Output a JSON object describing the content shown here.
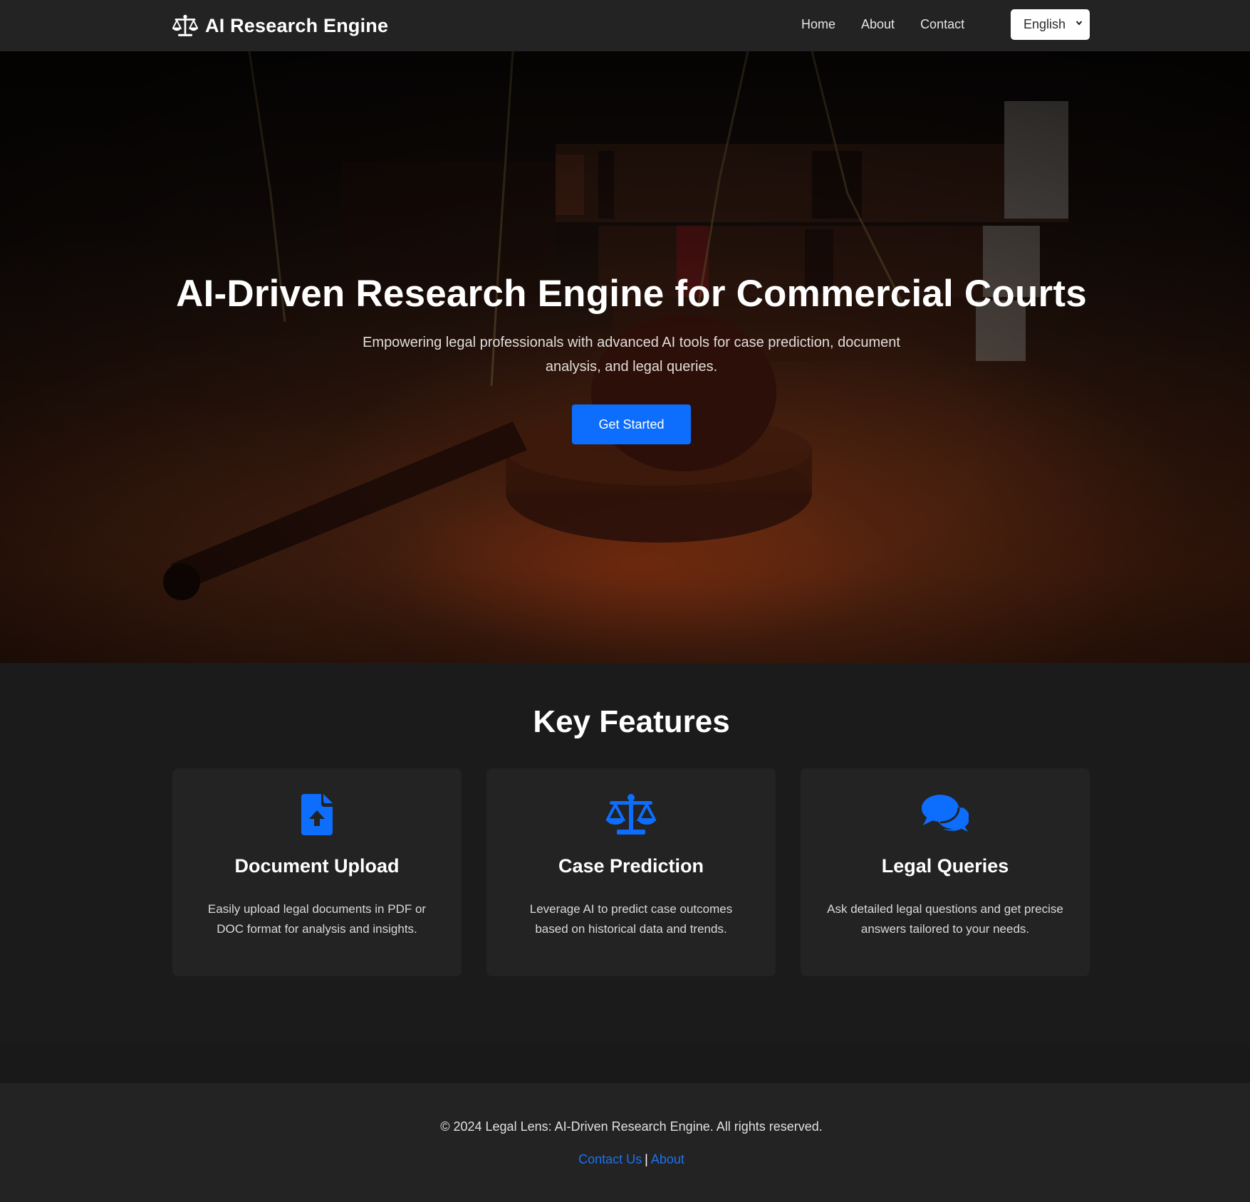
{
  "navbar": {
    "brand": "AI Research Engine",
    "brand_icon": "scale-balance-icon",
    "links": [
      "Home",
      "About",
      "Contact"
    ],
    "language_selected": "English"
  },
  "hero": {
    "title": "AI-Driven Research Engine for Commercial Courts",
    "subtitle": "Empowering legal professionals with advanced AI tools for case prediction, document analysis, and legal queries.",
    "cta": "Get Started"
  },
  "features": {
    "title": "Key Features",
    "cards": [
      {
        "icon": "file-upload-icon",
        "title": "Document Upload",
        "description": "Easily upload legal documents in PDF or DOC format for analysis and insights."
      },
      {
        "icon": "scale-balance-icon",
        "title": "Case Prediction",
        "description": "Leverage AI to predict case outcomes based on historical data and trends."
      },
      {
        "icon": "comments-icon",
        "title": "Legal Queries",
        "description": "Ask detailed legal questions and get precise answers tailored to your needs."
      }
    ]
  },
  "footer": {
    "copyright": "© 2024 Legal Lens: AI-Driven Research Engine. All rights reserved.",
    "links": [
      "Contact Us",
      "About"
    ],
    "separator": "|"
  },
  "colors": {
    "accent": "#0d6efd",
    "background": "#1b1b1c",
    "surface": "#232324",
    "link": "#1a73f0"
  }
}
